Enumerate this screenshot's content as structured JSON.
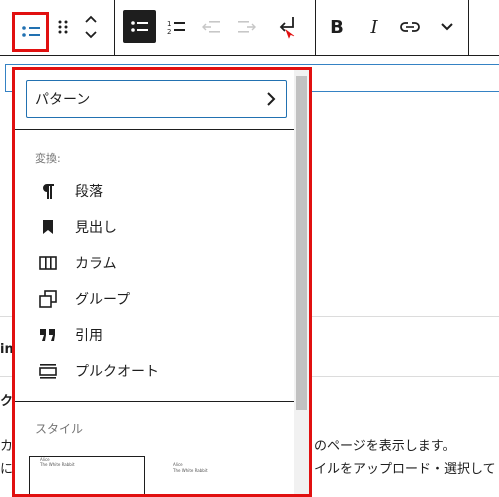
{
  "toolbar": {
    "list_style_icon": "unordered-list-icon",
    "drag_handle_icon": "drag-handle-icon",
    "move_icon": "move-up-down-icon",
    "unordered_icon": "unordered-list-icon",
    "ordered_icon": "ordered-list-icon",
    "outdent_icon": "outdent-icon",
    "indent_icon": "indent-icon",
    "newline_icon": "newline-icon",
    "bold_label": "B",
    "italic_label": "I",
    "link_icon": "link-icon",
    "more_icon": "chevron-down-icon"
  },
  "dropdown": {
    "pattern_label": "パターン",
    "transform_label": "変換:",
    "items": [
      {
        "label": "段落",
        "icon": "paragraph-icon"
      },
      {
        "label": "見出し",
        "icon": "heading-icon"
      },
      {
        "label": "カラム",
        "icon": "columns-icon"
      },
      {
        "label": "グループ",
        "icon": "group-icon"
      },
      {
        "label": "引用",
        "icon": "quote-icon"
      },
      {
        "label": "プルクオート",
        "icon": "pullquote-icon"
      }
    ],
    "style_label": "スタイル",
    "preview_default": {
      "item1": "Alice",
      "item2": "The White Rabbit"
    },
    "preview_circle": {
      "item1": "Alice",
      "item2": "The White Rabbit"
    }
  },
  "background": {
    "left_fragment_1": "in",
    "left_fragment_2": "ク",
    "left_fragment_3": "カ",
    "left_fragment_4": "に",
    "right_text_1": "のページを表示します。",
    "right_text_2": "イルをアップロード・選択して"
  },
  "colors": {
    "highlight": "#e11010",
    "focus": "#2271b1",
    "accent": "#3582c4"
  }
}
